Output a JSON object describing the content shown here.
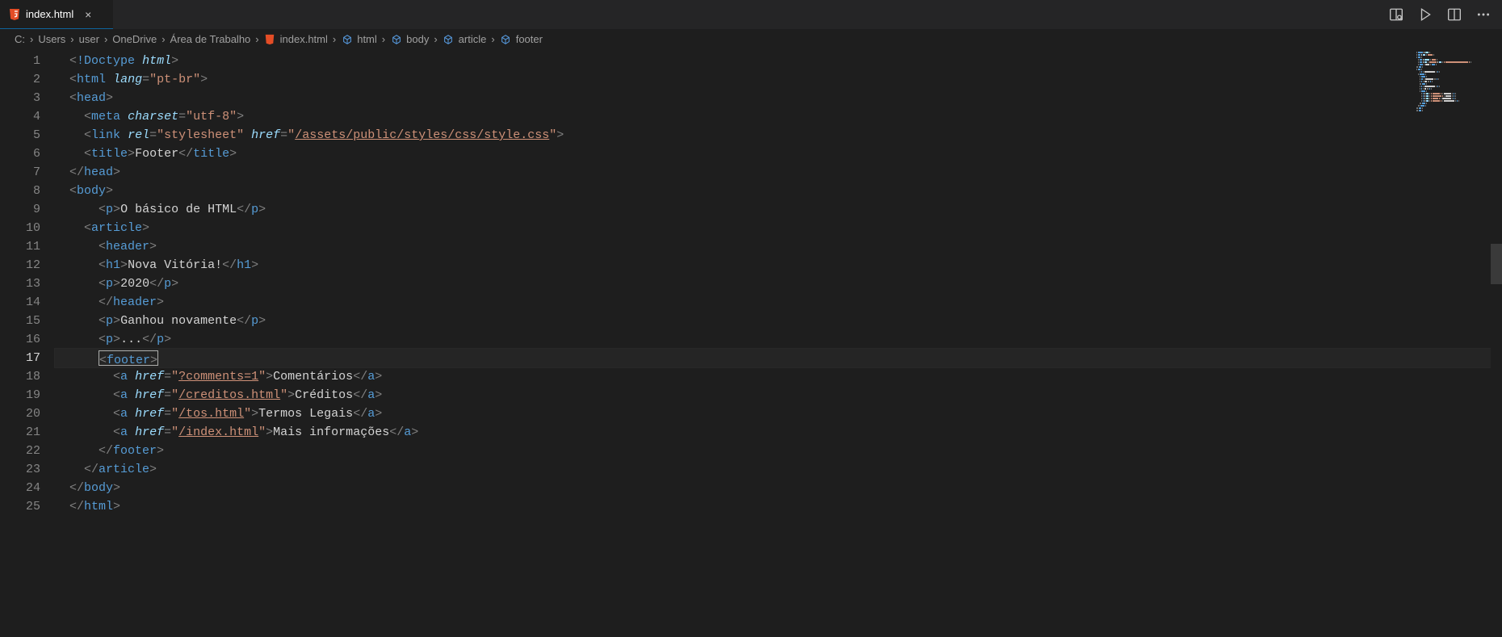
{
  "tab": {
    "label": "index.html",
    "icon": "html5-icon"
  },
  "breadcrumbs": {
    "path": [
      "C:",
      "Users",
      "user",
      "OneDrive",
      "Área de Trabalho"
    ],
    "file": {
      "name": "index.html",
      "icon": "html5-icon"
    },
    "symbols": [
      {
        "name": "html",
        "icon": "cube-icon"
      },
      {
        "name": "body",
        "icon": "cube-icon"
      },
      {
        "name": "article",
        "icon": "cube-icon"
      },
      {
        "name": "footer",
        "icon": "cube-icon"
      }
    ]
  },
  "editorActions": {
    "preview": "open-preview-icon",
    "run": "run-icon",
    "split": "split-editor-icon",
    "more": "more-icon"
  },
  "activeLine": 17,
  "code": {
    "lines": [
      {
        "n": 1,
        "indent": 0,
        "tokens": [
          {
            "t": "punc",
            "v": "<"
          },
          {
            "t": "doctype",
            "v": "!Doctype"
          },
          {
            "t": "text",
            "v": " "
          },
          {
            "t": "dockey",
            "v": "html"
          },
          {
            "t": "punc",
            "v": ">"
          }
        ]
      },
      {
        "n": 2,
        "indent": 0,
        "tokens": [
          {
            "t": "punc",
            "v": "<"
          },
          {
            "t": "tag",
            "v": "html"
          },
          {
            "t": "text",
            "v": " "
          },
          {
            "t": "attr",
            "v": "lang"
          },
          {
            "t": "punc",
            "v": "="
          },
          {
            "t": "val",
            "v": "\"pt-br\""
          },
          {
            "t": "punc",
            "v": ">"
          }
        ]
      },
      {
        "n": 3,
        "indent": 0,
        "tokens": [
          {
            "t": "punc",
            "v": "<"
          },
          {
            "t": "tag",
            "v": "head"
          },
          {
            "t": "punc",
            "v": ">"
          }
        ]
      },
      {
        "n": 4,
        "indent": 1,
        "tokens": [
          {
            "t": "punc",
            "v": "<"
          },
          {
            "t": "tag",
            "v": "meta"
          },
          {
            "t": "text",
            "v": " "
          },
          {
            "t": "attr",
            "v": "charset"
          },
          {
            "t": "punc",
            "v": "="
          },
          {
            "t": "val",
            "v": "\"utf-8\""
          },
          {
            "t": "punc",
            "v": ">"
          }
        ]
      },
      {
        "n": 5,
        "indent": 1,
        "tokens": [
          {
            "t": "punc",
            "v": "<"
          },
          {
            "t": "tag",
            "v": "link"
          },
          {
            "t": "text",
            "v": " "
          },
          {
            "t": "attr",
            "v": "rel"
          },
          {
            "t": "punc",
            "v": "="
          },
          {
            "t": "val",
            "v": "\"stylesheet\""
          },
          {
            "t": "text",
            "v": " "
          },
          {
            "t": "attr",
            "v": "href"
          },
          {
            "t": "punc",
            "v": "="
          },
          {
            "t": "val",
            "v": "\""
          },
          {
            "t": "val",
            "v": "/assets/public/styles/css/style.css",
            "u": true
          },
          {
            "t": "val",
            "v": "\""
          },
          {
            "t": "punc",
            "v": ">"
          }
        ]
      },
      {
        "n": 6,
        "indent": 1,
        "tokens": [
          {
            "t": "punc",
            "v": "<"
          },
          {
            "t": "tag",
            "v": "title"
          },
          {
            "t": "punc",
            "v": ">"
          },
          {
            "t": "text",
            "v": "Footer"
          },
          {
            "t": "punc",
            "v": "</"
          },
          {
            "t": "tag",
            "v": "title"
          },
          {
            "t": "punc",
            "v": ">"
          }
        ]
      },
      {
        "n": 7,
        "indent": 0,
        "tokens": [
          {
            "t": "punc",
            "v": "</"
          },
          {
            "t": "tag",
            "v": "head"
          },
          {
            "t": "punc",
            "v": ">"
          }
        ]
      },
      {
        "n": 8,
        "indent": 0,
        "tokens": [
          {
            "t": "punc",
            "v": "<"
          },
          {
            "t": "tag",
            "v": "body"
          },
          {
            "t": "punc",
            "v": ">"
          }
        ]
      },
      {
        "n": 9,
        "indent": 2,
        "tokens": [
          {
            "t": "punc",
            "v": "<"
          },
          {
            "t": "tag",
            "v": "p"
          },
          {
            "t": "punc",
            "v": ">"
          },
          {
            "t": "text",
            "v": "O básico de HTML"
          },
          {
            "t": "punc",
            "v": "</"
          },
          {
            "t": "tag",
            "v": "p"
          },
          {
            "t": "punc",
            "v": ">"
          }
        ]
      },
      {
        "n": 10,
        "indent": 1,
        "tokens": [
          {
            "t": "punc",
            "v": "<"
          },
          {
            "t": "tag",
            "v": "article"
          },
          {
            "t": "punc",
            "v": ">"
          }
        ]
      },
      {
        "n": 11,
        "indent": 2,
        "tokens": [
          {
            "t": "punc",
            "v": "<"
          },
          {
            "t": "tag",
            "v": "header"
          },
          {
            "t": "punc",
            "v": ">"
          }
        ]
      },
      {
        "n": 12,
        "indent": 2,
        "tokens": [
          {
            "t": "punc",
            "v": "<"
          },
          {
            "t": "tag",
            "v": "h1"
          },
          {
            "t": "punc",
            "v": ">"
          },
          {
            "t": "text",
            "v": "Nova Vitória!"
          },
          {
            "t": "punc",
            "v": "</"
          },
          {
            "t": "tag",
            "v": "h1"
          },
          {
            "t": "punc",
            "v": ">"
          }
        ]
      },
      {
        "n": 13,
        "indent": 2,
        "tokens": [
          {
            "t": "punc",
            "v": "<"
          },
          {
            "t": "tag",
            "v": "p"
          },
          {
            "t": "punc",
            "v": ">"
          },
          {
            "t": "text",
            "v": "2020"
          },
          {
            "t": "punc",
            "v": "</"
          },
          {
            "t": "tag",
            "v": "p"
          },
          {
            "t": "punc",
            "v": ">"
          }
        ]
      },
      {
        "n": 14,
        "indent": 2,
        "tokens": [
          {
            "t": "punc",
            "v": "</"
          },
          {
            "t": "tag",
            "v": "header"
          },
          {
            "t": "punc",
            "v": ">"
          }
        ]
      },
      {
        "n": 15,
        "indent": 2,
        "tokens": [
          {
            "t": "punc",
            "v": "<"
          },
          {
            "t": "tag",
            "v": "p"
          },
          {
            "t": "punc",
            "v": ">"
          },
          {
            "t": "text",
            "v": "Ganhou novamente"
          },
          {
            "t": "punc",
            "v": "</"
          },
          {
            "t": "tag",
            "v": "p"
          },
          {
            "t": "punc",
            "v": ">"
          }
        ]
      },
      {
        "n": 16,
        "indent": 2,
        "tokens": [
          {
            "t": "punc",
            "v": "<"
          },
          {
            "t": "tag",
            "v": "p"
          },
          {
            "t": "punc",
            "v": ">"
          },
          {
            "t": "text",
            "v": "..."
          },
          {
            "t": "punc",
            "v": "</"
          },
          {
            "t": "tag",
            "v": "p"
          },
          {
            "t": "punc",
            "v": ">"
          }
        ]
      },
      {
        "n": 17,
        "indent": 2,
        "tokens": [
          {
            "t": "box-open"
          },
          {
            "t": "punc",
            "v": "<"
          },
          {
            "t": "tag",
            "v": "footer"
          },
          {
            "t": "punc",
            "v": ">"
          },
          {
            "t": "box-close"
          }
        ]
      },
      {
        "n": 18,
        "indent": 3,
        "tokens": [
          {
            "t": "punc",
            "v": "<"
          },
          {
            "t": "tag",
            "v": "a"
          },
          {
            "t": "text",
            "v": " "
          },
          {
            "t": "attr",
            "v": "href"
          },
          {
            "t": "punc",
            "v": "="
          },
          {
            "t": "val",
            "v": "\""
          },
          {
            "t": "val",
            "v": "?comments=1",
            "u": true
          },
          {
            "t": "val",
            "v": "\""
          },
          {
            "t": "punc",
            "v": ">"
          },
          {
            "t": "text",
            "v": "Comentários"
          },
          {
            "t": "punc",
            "v": "</"
          },
          {
            "t": "tag",
            "v": "a"
          },
          {
            "t": "punc",
            "v": ">"
          }
        ]
      },
      {
        "n": 19,
        "indent": 3,
        "tokens": [
          {
            "t": "punc",
            "v": "<"
          },
          {
            "t": "tag",
            "v": "a"
          },
          {
            "t": "text",
            "v": " "
          },
          {
            "t": "attr",
            "v": "href"
          },
          {
            "t": "punc",
            "v": "="
          },
          {
            "t": "val",
            "v": "\""
          },
          {
            "t": "val",
            "v": "/creditos.html",
            "u": true
          },
          {
            "t": "val",
            "v": "\""
          },
          {
            "t": "punc",
            "v": ">"
          },
          {
            "t": "text",
            "v": "Créditos"
          },
          {
            "t": "punc",
            "v": "</"
          },
          {
            "t": "tag",
            "v": "a"
          },
          {
            "t": "punc",
            "v": ">"
          }
        ]
      },
      {
        "n": 20,
        "indent": 3,
        "tokens": [
          {
            "t": "punc",
            "v": "<"
          },
          {
            "t": "tag",
            "v": "a"
          },
          {
            "t": "text",
            "v": " "
          },
          {
            "t": "attr",
            "v": "href"
          },
          {
            "t": "punc",
            "v": "="
          },
          {
            "t": "val",
            "v": "\""
          },
          {
            "t": "val",
            "v": "/tos.html",
            "u": true
          },
          {
            "t": "val",
            "v": "\""
          },
          {
            "t": "punc",
            "v": ">"
          },
          {
            "t": "text",
            "v": "Termos Legais"
          },
          {
            "t": "punc",
            "v": "</"
          },
          {
            "t": "tag",
            "v": "a"
          },
          {
            "t": "punc",
            "v": ">"
          }
        ]
      },
      {
        "n": 21,
        "indent": 3,
        "tokens": [
          {
            "t": "punc",
            "v": "<"
          },
          {
            "t": "tag",
            "v": "a"
          },
          {
            "t": "text",
            "v": " "
          },
          {
            "t": "attr",
            "v": "href"
          },
          {
            "t": "punc",
            "v": "="
          },
          {
            "t": "val",
            "v": "\""
          },
          {
            "t": "val",
            "v": "/index.html",
            "u": true
          },
          {
            "t": "val",
            "v": "\""
          },
          {
            "t": "punc",
            "v": ">"
          },
          {
            "t": "text",
            "v": "Mais informações"
          },
          {
            "t": "punc",
            "v": "</"
          },
          {
            "t": "tag",
            "v": "a"
          },
          {
            "t": "punc",
            "v": ">"
          }
        ]
      },
      {
        "n": 22,
        "indent": 2,
        "tokens": [
          {
            "t": "punc",
            "v": "</"
          },
          {
            "t": "tag",
            "v": "footer"
          },
          {
            "t": "punc",
            "v": ">"
          }
        ]
      },
      {
        "n": 23,
        "indent": 1,
        "tokens": [
          {
            "t": "punc",
            "v": "</"
          },
          {
            "t": "tag",
            "v": "article"
          },
          {
            "t": "punc",
            "v": ">"
          }
        ]
      },
      {
        "n": 24,
        "indent": 0,
        "tokens": [
          {
            "t": "punc",
            "v": "</"
          },
          {
            "t": "tag",
            "v": "body"
          },
          {
            "t": "punc",
            "v": ">"
          }
        ]
      },
      {
        "n": 25,
        "indent": 0,
        "tokens": [
          {
            "t": "punc",
            "v": "</"
          },
          {
            "t": "tag",
            "v": "html"
          },
          {
            "t": "punc",
            "v": ">"
          }
        ]
      }
    ]
  }
}
